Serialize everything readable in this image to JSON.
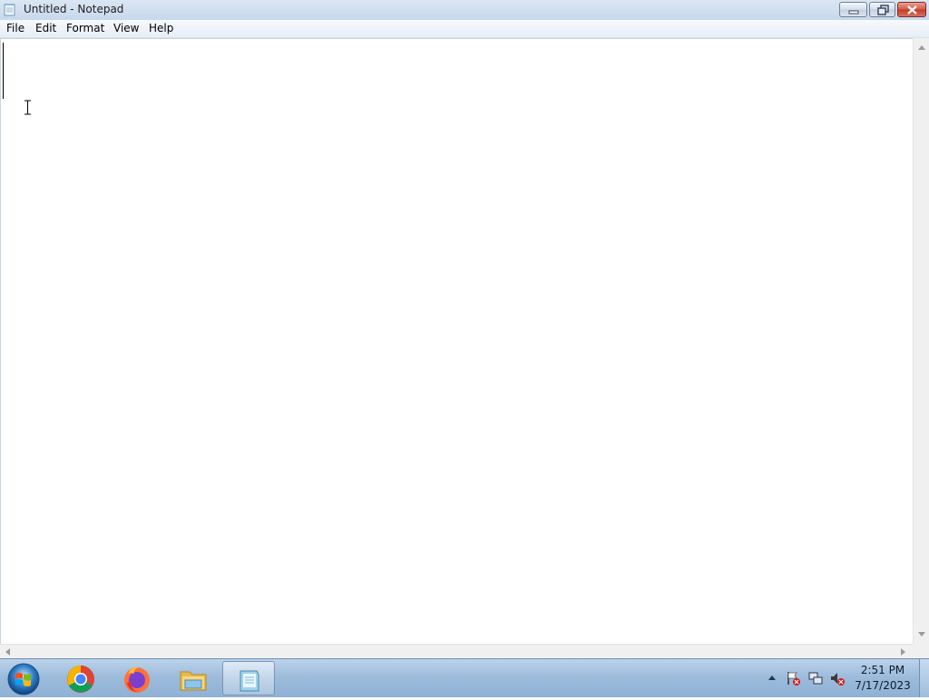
{
  "window": {
    "title": "Untitled - Notepad",
    "icon": "notepad-icon"
  },
  "caption_buttons": {
    "minimize": "minimize-icon",
    "restore": "restore-icon",
    "close": "close-icon"
  },
  "menu": {
    "items": [
      "File",
      "Edit",
      "Format",
      "View",
      "Help"
    ]
  },
  "editor": {
    "content": ""
  },
  "taskbar": {
    "start": "windows-start-orb",
    "pinned": [
      "chrome-icon",
      "firefox-icon",
      "file-explorer-icon",
      "notepad-icon"
    ],
    "active": "notepad-icon",
    "tray_icons": [
      "show-hidden-icons-arrow",
      "action-center-flag-icon",
      "network-icon",
      "volume-muted-icon"
    ],
    "clock": {
      "time": "2:51 PM",
      "date": "7/17/2023"
    }
  },
  "colors": {
    "titlebar": "#c7d8ec",
    "close_button": "#c13a26",
    "taskbar": "#9dbcdc"
  }
}
